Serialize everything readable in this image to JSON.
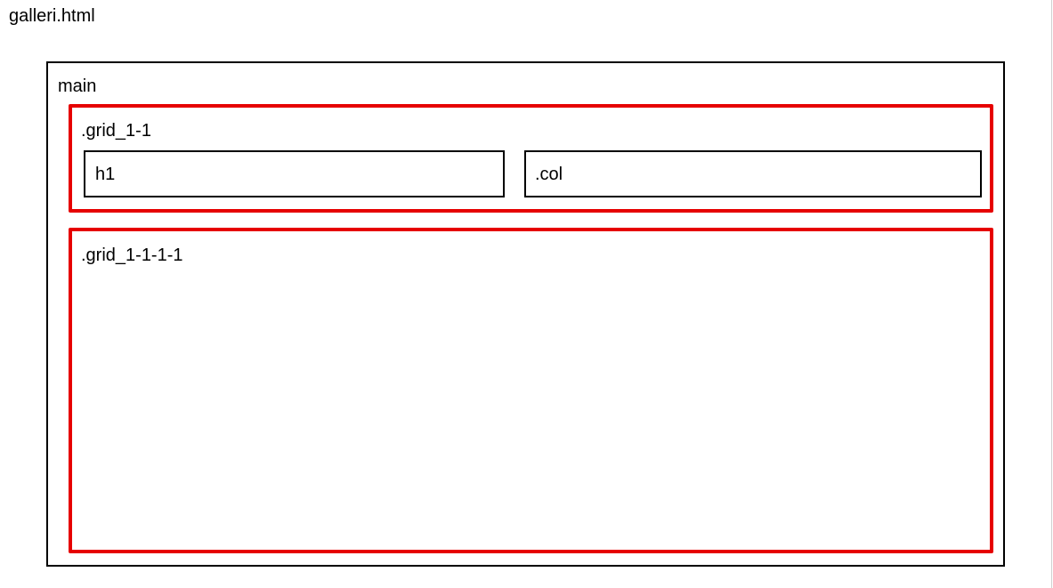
{
  "document": {
    "filename": "galleri.html"
  },
  "wireframe": {
    "main_label": "main",
    "grid_top": {
      "label": ".grid_1-1",
      "left_child": "h1",
      "right_child": ".col"
    },
    "grid_bottom": {
      "label": ".grid_1-1-1-1"
    }
  },
  "colors": {
    "grid_border": "#e60000",
    "element_border": "#000000",
    "background": "#ffffff"
  }
}
